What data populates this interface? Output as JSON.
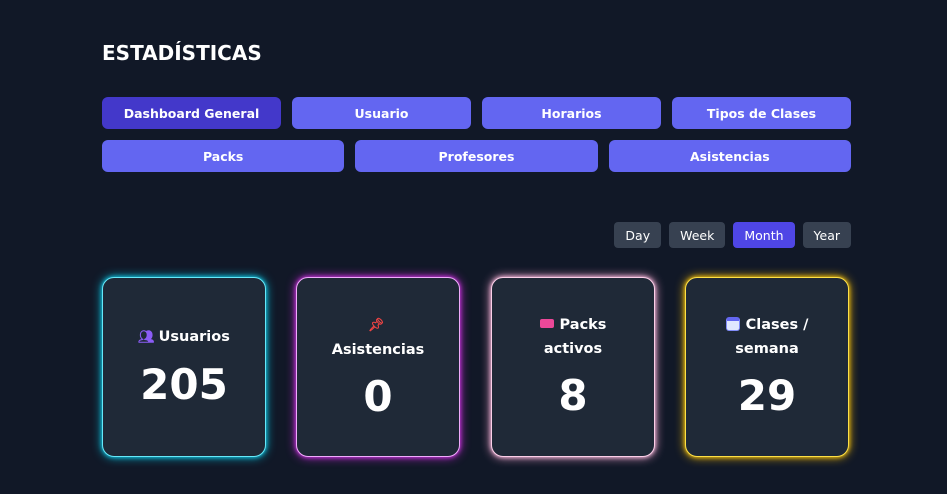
{
  "page": {
    "title": "ESTADÍSTICAS"
  },
  "tabs": {
    "row1": [
      "Dashboard General",
      "Usuario",
      "Horarios",
      "Tipos de Clases"
    ],
    "row2": [
      "Packs",
      "Profesores",
      "Asistencias"
    ],
    "active": "Dashboard General"
  },
  "period": {
    "options": [
      "Day",
      "Week",
      "Month",
      "Year"
    ],
    "active": "Month"
  },
  "cards": [
    {
      "label": "Usuarios",
      "value": "205",
      "icon": "users-icon",
      "glow": "#22d3ee"
    },
    {
      "label": "Asistencias",
      "value": "0",
      "icon": "pushpin-icon",
      "glow": "#d946ef"
    },
    {
      "label": "Packs activos",
      "value": "8",
      "icon": "ticket-icon",
      "glow": "#fbcfe8"
    },
    {
      "label": "Clases / semana",
      "value": "29",
      "icon": "calendar-icon",
      "glow": "#facc15"
    }
  ],
  "colors": {
    "background": "#111827",
    "tab": "#6366f1",
    "tab_active": "#4338ca",
    "card": "#1f2937"
  }
}
